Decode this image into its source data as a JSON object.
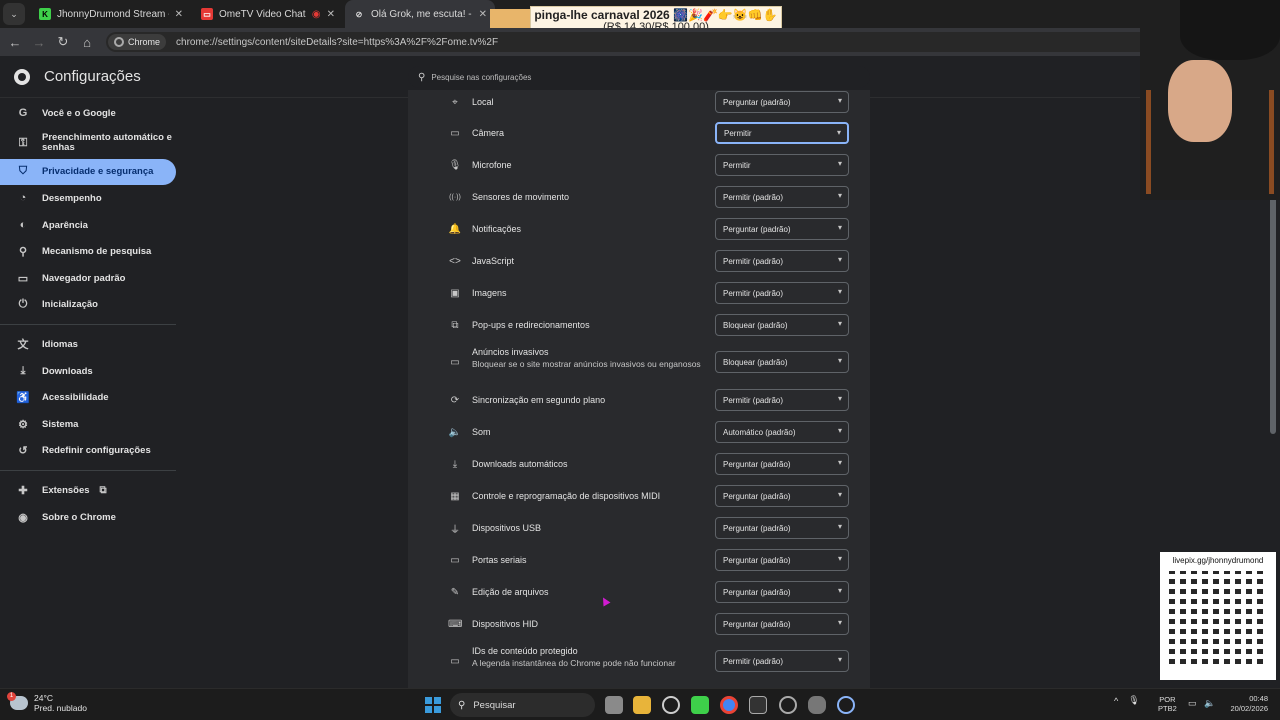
{
  "browser": {
    "tabs": [
      {
        "title": "JhonnyDrumond Stream - Watc",
        "favicon_color": "#3ed04a",
        "favicon_glyph": "K",
        "active": false
      },
      {
        "title": "OmeTV Video Chat — Ome",
        "favicon_color": "#e53935",
        "favicon_glyph": "▭",
        "active": false
      },
      {
        "title": "Olá Grok, me escuta! - Grok",
        "favicon_color": "#dddddd",
        "favicon_glyph": "⊘",
        "active": true
      }
    ],
    "site_chip": "Chrome",
    "url": "chrome://settings/content/siteDetails?site=https%3A%2F%2Fome.tv%2F"
  },
  "overlay": {
    "line1": "pinga-lhe carnaval 2026 🎆🎉🧨👉😺👊✋",
    "line2": "(R$ 14,30/R$ 100,00)"
  },
  "settings": {
    "title": "Configurações",
    "search_placeholder": "Pesquise nas configurações"
  },
  "sidebar": {
    "items": [
      {
        "label": "Você e o Google",
        "icon": "google-icon",
        "glyph": "G"
      },
      {
        "label": "Preenchimento automático e senhas",
        "icon": "key-icon",
        "glyph": "⚿"
      },
      {
        "label": "Privacidade e segurança",
        "icon": "shield-icon",
        "glyph": "⛉"
      },
      {
        "label": "Desempenho",
        "icon": "speedometer-icon",
        "glyph": "◔"
      },
      {
        "label": "Aparência",
        "icon": "palette-icon",
        "glyph": "◐"
      },
      {
        "label": "Mecanismo de pesquisa",
        "icon": "search-icon",
        "glyph": "⚲"
      },
      {
        "label": "Navegador padrão",
        "icon": "browser-icon",
        "glyph": "▭"
      },
      {
        "label": "Inicialização",
        "icon": "power-icon",
        "glyph": "⏻"
      },
      {
        "label": "Idiomas",
        "icon": "translate-icon",
        "glyph": "文"
      },
      {
        "label": "Downloads",
        "icon": "download-icon",
        "glyph": "⤓"
      },
      {
        "label": "Acessibilidade",
        "icon": "accessibility-icon",
        "glyph": "♿"
      },
      {
        "label": "Sistema",
        "icon": "wrench-icon",
        "glyph": "⚙"
      },
      {
        "label": "Redefinir configurações",
        "icon": "reset-icon",
        "glyph": "↺"
      },
      {
        "label": "Extensões",
        "icon": "puzzle-icon",
        "glyph": "✚"
      },
      {
        "label": "Sobre o Chrome",
        "icon": "chrome-icon",
        "glyph": "◉"
      }
    ]
  },
  "permissions": [
    {
      "label": "Local",
      "sub": "",
      "value": "Perguntar (padrão)",
      "icon": "location-icon",
      "glyph": "⌖"
    },
    {
      "label": "Câmera",
      "sub": "",
      "value": "Permitir",
      "icon": "camera-icon",
      "glyph": "▭"
    },
    {
      "label": "Microfone",
      "sub": "",
      "value": "Permitir",
      "icon": "microphone-icon",
      "glyph": "🎙"
    },
    {
      "label": "Sensores de movimento",
      "sub": "",
      "value": "Permitir (padrão)",
      "icon": "sensors-icon",
      "glyph": "((·))"
    },
    {
      "label": "Notificações",
      "sub": "",
      "value": "Perguntar (padrão)",
      "icon": "bell-icon",
      "glyph": "🔔"
    },
    {
      "label": "JavaScript",
      "sub": "",
      "value": "Permitir (padrão)",
      "icon": "code-icon",
      "glyph": "<>"
    },
    {
      "label": "Imagens",
      "sub": "",
      "value": "Permitir (padrão)",
      "icon": "image-icon",
      "glyph": "▣"
    },
    {
      "label": "Pop-ups e redirecionamentos",
      "sub": "",
      "value": "Bloquear (padrão)",
      "icon": "popup-icon",
      "glyph": "⧉"
    },
    {
      "label": "Anúncios invasivos",
      "sub": "Bloquear se o site mostrar anúncios invasivos ou enganosos",
      "value": "Bloquear (padrão)",
      "icon": "ads-icon",
      "glyph": "▭"
    },
    {
      "label": "Sincronização em segundo plano",
      "sub": "",
      "value": "Permitir (padrão)",
      "icon": "sync-icon",
      "glyph": "⟳"
    },
    {
      "label": "Som",
      "sub": "",
      "value": "Automático (padrão)",
      "icon": "speaker-icon",
      "glyph": "🔈"
    },
    {
      "label": "Downloads automáticos",
      "sub": "",
      "value": "Perguntar (padrão)",
      "icon": "download-icon",
      "glyph": "⤓"
    },
    {
      "label": "Controle e reprogramação de dispositivos MIDI",
      "sub": "",
      "value": "Perguntar (padrão)",
      "icon": "piano-icon",
      "glyph": "▦"
    },
    {
      "label": "Dispositivos USB",
      "sub": "",
      "value": "Perguntar (padrão)",
      "icon": "usb-icon",
      "glyph": "⏚"
    },
    {
      "label": "Portas seriais",
      "sub": "",
      "value": "Perguntar (padrão)",
      "icon": "serial-port-icon",
      "glyph": "▭"
    },
    {
      "label": "Edição de arquivos",
      "sub": "",
      "value": "Perguntar (padrão)",
      "icon": "file-edit-icon",
      "glyph": "✎"
    },
    {
      "label": "Dispositivos HID",
      "sub": "",
      "value": "Perguntar (padrão)",
      "icon": "hid-icon",
      "glyph": "⌨"
    },
    {
      "label": "IDs de conteúdo protegido",
      "sub": "A legenda instantânea do Chrome pode não funcionar",
      "value": "Permitir (padrão)",
      "icon": "protected-content-icon",
      "glyph": "▭"
    }
  ],
  "qr": {
    "caption": "livepix.gg/jhonnydrumond"
  },
  "taskbar": {
    "weather_temp": "24°C",
    "weather_desc": "Pred. nublado",
    "search_label": "Pesquisar",
    "lang_line1": "POR",
    "lang_line2": "PTB2",
    "time": "00:48",
    "date": "20/02/2026"
  }
}
